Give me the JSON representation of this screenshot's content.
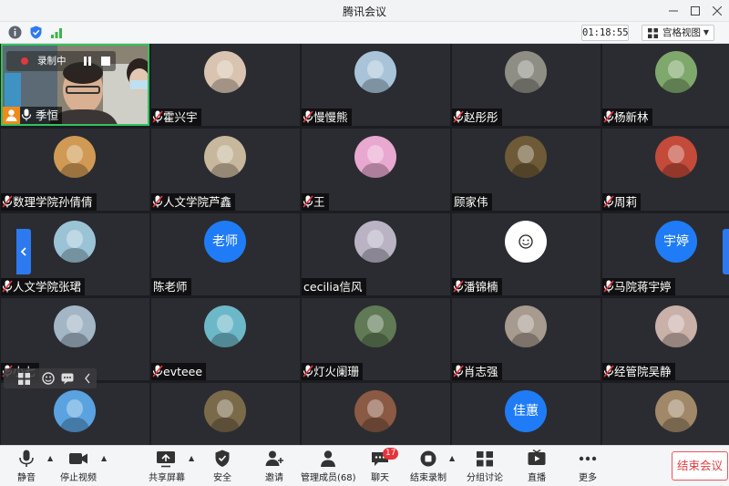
{
  "window": {
    "title": "腾讯会议"
  },
  "status": {
    "timer": "01:18:55",
    "view_label": "宫格视图"
  },
  "recording": {
    "label": "录制中"
  },
  "self": {
    "name": "季恒"
  },
  "participants": [
    {
      "name": "霍兴宇",
      "avatar": "photo"
    },
    {
      "name": "慢慢熊",
      "avatar": "photo"
    },
    {
      "name": "赵彤彤",
      "avatar": "photo"
    },
    {
      "name": "杨新林",
      "avatar": "photo"
    },
    {
      "name": "数理学院孙倩倩",
      "avatar": "photo"
    },
    {
      "name": "人文学院芦鑫",
      "avatar": "photo"
    },
    {
      "name": "王",
      "avatar": "photo"
    },
    {
      "name": "顾家伟",
      "avatar": "photo"
    },
    {
      "name": "周莉",
      "avatar": "photo"
    },
    {
      "name": "人文学院张珺",
      "avatar": "photo"
    },
    {
      "name": "陈老师",
      "avatar_text": "老师"
    },
    {
      "name": "cecilia信风",
      "avatar": "photo"
    },
    {
      "name": "潘锦楠",
      "avatar": "smile"
    },
    {
      "name": "马院蒋宇婷",
      "avatar_text": "宇婷"
    },
    {
      "name": "小七",
      "avatar": "photo"
    },
    {
      "name": "evteee",
      "avatar": "photo"
    },
    {
      "name": "灯火阑珊",
      "avatar": "photo"
    },
    {
      "name": "肖志强",
      "avatar": "photo"
    },
    {
      "name": "经管院吴静",
      "avatar": "photo"
    },
    {
      "avatar": "photo"
    },
    {
      "avatar": "photo"
    },
    {
      "avatar": "photo"
    },
    {
      "avatar_text": "佳蕙"
    },
    {
      "avatar": "photo"
    }
  ],
  "toolbar": {
    "mute": "静音",
    "stop_video": "停止视频",
    "share_screen": "共享屏幕",
    "security": "安全",
    "invite": "邀请",
    "members": "管理成员(68)",
    "chat": "聊天",
    "chat_badge": "17",
    "end_record": "结束录制",
    "breakout": "分组讨论",
    "live": "直播",
    "more": "更多",
    "end_meeting": "结束会议"
  },
  "colors": {
    "accent": "#1f7cf6",
    "active_border": "#32c25f",
    "end": "#e23d42",
    "tile_bg": "#2b2c31"
  }
}
